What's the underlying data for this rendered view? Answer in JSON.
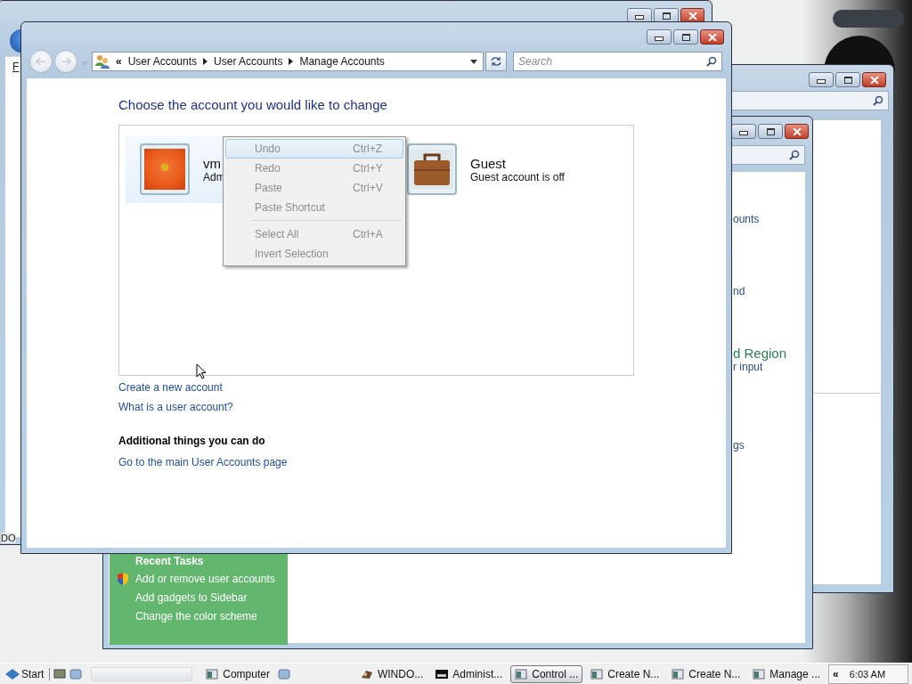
{
  "back_window": {
    "menu_letter": "F"
  },
  "desktop_icon_label": "DO",
  "right_window": {
    "fragments": [
      {
        "text": "ounts",
        "kind": "link"
      },
      {
        "text": "nd",
        "kind": "link"
      },
      {
        "text": "d Region",
        "kind": "title"
      },
      {
        "text": "r input",
        "kind": "link"
      },
      {
        "text": "gs",
        "kind": "link"
      }
    ],
    "recent_tasks": {
      "title": "Recent Tasks",
      "items": [
        "Add or remove user accounts",
        "Add gadgets to Sidebar",
        "Change the color scheme"
      ]
    }
  },
  "main_window": {
    "breadcrumb_prefix": "«",
    "breadcrumb": [
      "User Accounts",
      "User Accounts",
      "Manage Accounts"
    ],
    "search": {
      "placeholder": "Search"
    },
    "heading": "Choose the account you would like to change",
    "accounts": [
      {
        "name": "vm",
        "role": "Adm",
        "selected": true
      },
      {
        "name": "Guest",
        "role": "Guest account is off",
        "selected": false
      }
    ],
    "links": [
      "Create a new account",
      "What is a user account?"
    ],
    "section_title": "Additional things you can do",
    "section_links": [
      "Go to the main User Accounts page"
    ]
  },
  "context_menu": [
    {
      "kind": "item",
      "label": "Undo",
      "shortcut": "Ctrl+Z",
      "disabled": true,
      "selected": true
    },
    {
      "kind": "item",
      "label": "Redo",
      "shortcut": "Ctrl+Y",
      "disabled": true,
      "selected": false
    },
    {
      "kind": "item",
      "label": "Paste",
      "shortcut": "Ctrl+V",
      "disabled": true,
      "selected": false
    },
    {
      "kind": "item",
      "label": "Paste Shortcut",
      "disabled": true,
      "selected": false
    },
    {
      "kind": "separator"
    },
    {
      "kind": "item",
      "label": "Select All",
      "shortcut": "Ctrl+A",
      "disabled": true,
      "selected": false
    },
    {
      "kind": "item",
      "label": "Invert Selection",
      "disabled": true,
      "selected": false
    }
  ],
  "taskbar": {
    "start": "Start",
    "buttons": [
      {
        "label": "Computer",
        "selected": false
      },
      {
        "label": "WINDO...",
        "selected": false
      },
      {
        "label": "Administ...",
        "selected": false
      },
      {
        "label": "Control ...",
        "selected": true
      },
      {
        "label": "Create N...",
        "selected": false
      },
      {
        "label": "Create N...",
        "selected": false
      },
      {
        "label": "Manage ...",
        "selected": false
      }
    ],
    "tray_toggle": "«",
    "clock": "6:03 AM"
  }
}
